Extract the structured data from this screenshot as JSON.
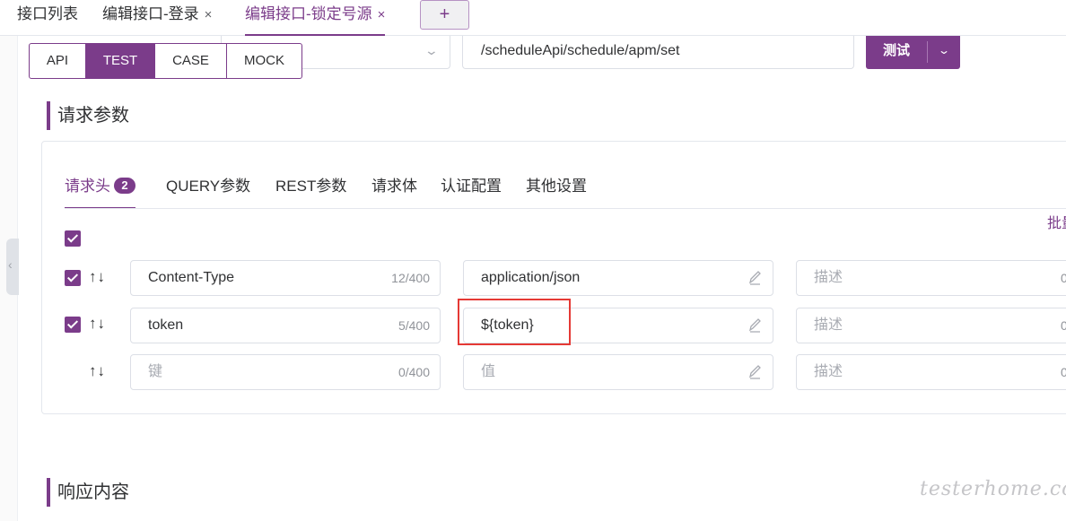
{
  "tabs": [
    {
      "label": "接口列表",
      "closable": false,
      "active": false
    },
    {
      "label": "编辑接口-登录",
      "closable": true,
      "active": false
    },
    {
      "label": "编辑接口-锁定号源",
      "closable": true,
      "active": true
    }
  ],
  "tab_close_glyph": "×",
  "tab_add_glyph": "+",
  "side_handle_glyph": "‹",
  "request": {
    "url": "/scheduleApi/schedule/apm/set",
    "test_button": "测试",
    "dropdown_glyph": "⌄"
  },
  "mode_tabs": [
    {
      "label": "API",
      "active": false
    },
    {
      "label": "TEST",
      "active": true
    },
    {
      "label": "CASE",
      "active": false
    },
    {
      "label": "MOCK",
      "active": false
    }
  ],
  "sections": {
    "request_params": "请求参数",
    "response": "响应内容"
  },
  "param_tabs": [
    {
      "label": "请求头",
      "badge": "2",
      "active": true
    },
    {
      "label": "QUERY参数",
      "active": false
    },
    {
      "label": "REST参数",
      "active": false
    },
    {
      "label": "请求体",
      "active": false
    },
    {
      "label": "认证配置",
      "active": false
    },
    {
      "label": "其他设置",
      "active": false
    }
  ],
  "batch_edit_label": "批量",
  "arrows_glyph": "↑↓",
  "headers": [
    {
      "key": "Content-Type",
      "key_count": "12/400",
      "value": "application/json",
      "desc_placeholder": "描述",
      "desc_count": "0",
      "checked": true
    },
    {
      "key": "token",
      "key_count": "5/400",
      "value": "${token}",
      "desc_placeholder": "描述",
      "desc_count": "0",
      "checked": true
    },
    {
      "key_placeholder": "键",
      "key_count": "0/400",
      "value_placeholder": "值",
      "desc_placeholder": "描述",
      "desc_count": "0",
      "checked": false
    }
  ],
  "watermark": "testerhome.com",
  "colors": {
    "accent": "#7b3c8a",
    "highlight": "#e53935"
  }
}
